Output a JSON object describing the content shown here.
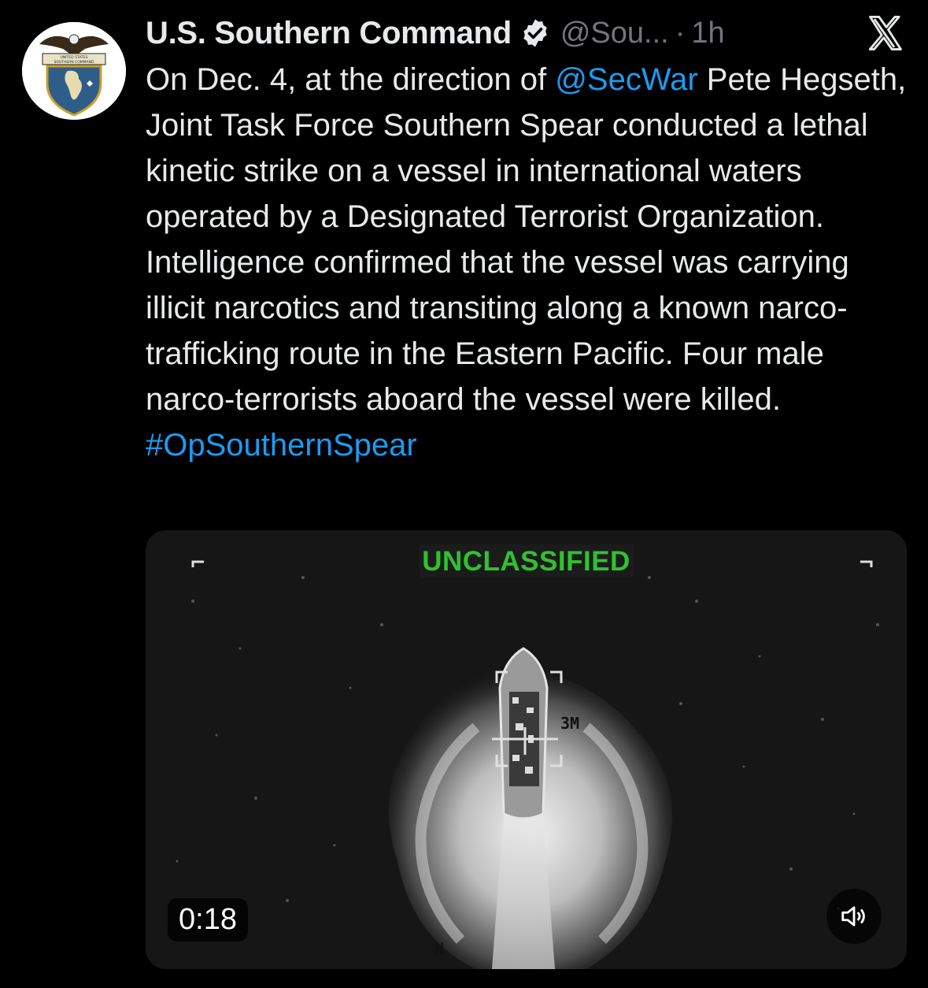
{
  "post": {
    "author_name": "U.S. Southern Command",
    "handle": "@Sou...",
    "separator": "·",
    "time": "1h",
    "avatar": {
      "line1": "UNITED STATES",
      "line2": "SOUTHERN COMMAND"
    },
    "text_parts": {
      "p1": "On Dec. 4, at the direction of ",
      "mention": "@SecWar",
      "p2": " Pete Hegseth, Joint Task Force Southern Spear conducted a lethal kinetic strike on a vessel in international waters operated by a Designated Terrorist Organization. Intelligence confirmed that the vessel was carrying illicit narcotics and transiting along a known narco-trafficking route in the Eastern Pacific. Four male narco-terrorists aboard the vessel were killed. ",
      "hashtag": "#OpSouthernSpear"
    }
  },
  "media": {
    "classification_label": "UNCLASSIFIED",
    "range_label": "3M",
    "north_label": "N",
    "duration": "0:18"
  },
  "icons": {
    "verified": "verified-badge-icon",
    "platform": "x-logo-icon",
    "sound": "speaker-muted-icon"
  },
  "colors": {
    "background": "#000000",
    "text": "#e7e9ea",
    "muted": "#71767b",
    "link": "#1d9bf0",
    "classification": "#2ec22e"
  }
}
